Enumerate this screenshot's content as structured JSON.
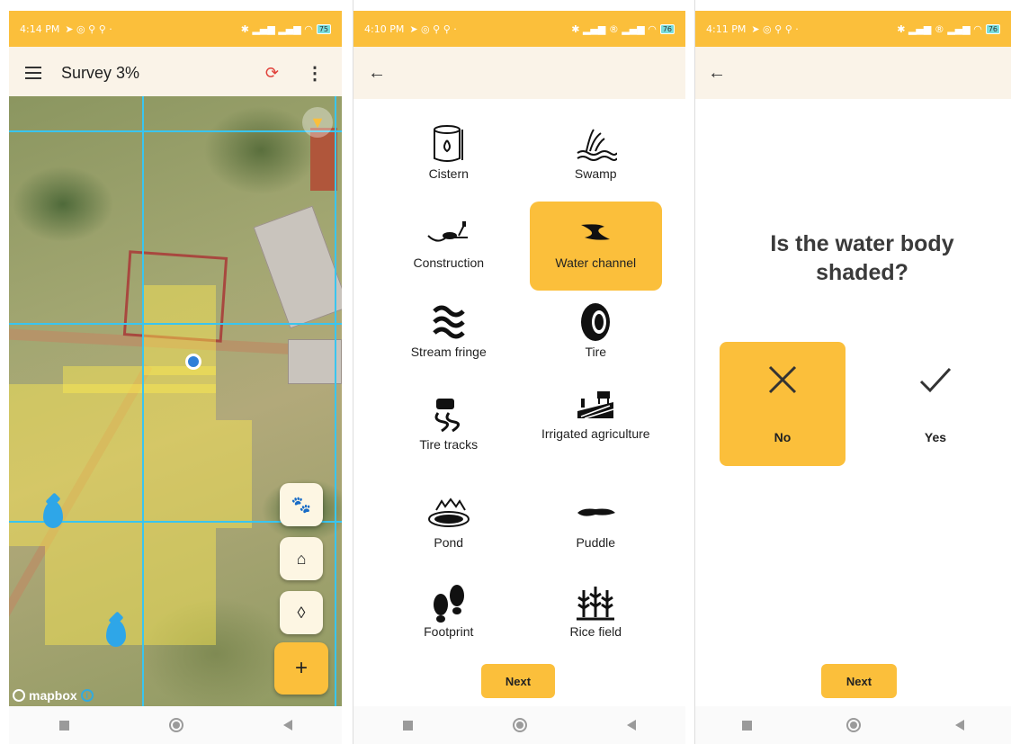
{
  "screens": {
    "map": {
      "status_time": "4:14 PM",
      "battery": "75",
      "title": "Survey 3%",
      "menu_icon": "hamburger-menu-icon",
      "sync_icon": "sync-off-icon",
      "more_icon": "more-vertical-icon",
      "layer_icon": "wifi-signal-icon",
      "map_attribution": "mapbox",
      "fab_actions": [
        "paw-icon",
        "home-icon",
        "water-drop-plus-icon"
      ],
      "fab_add": "+"
    },
    "categories": {
      "status_time": "4:10 PM",
      "battery": "76",
      "items": [
        {
          "label": "Cistern",
          "icon": "cistern-icon",
          "selected": false
        },
        {
          "label": "Swamp",
          "icon": "swamp-icon",
          "selected": false
        },
        {
          "label": "Construction",
          "icon": "construction-icon",
          "selected": false
        },
        {
          "label": "Water channel",
          "icon": "water-channel-icon",
          "selected": true
        },
        {
          "label": "Stream fringe",
          "icon": "stream-fringe-icon",
          "selected": false
        },
        {
          "label": "Tire",
          "icon": "tire-icon",
          "selected": false
        },
        {
          "label": "Tire tracks",
          "icon": "tire-tracks-icon",
          "selected": false
        },
        {
          "label": "Irrigated agriculture",
          "icon": "irrigated-agriculture-icon",
          "selected": false
        },
        {
          "label": "Pond",
          "icon": "pond-icon",
          "selected": false
        },
        {
          "label": "Puddle",
          "icon": "puddle-icon",
          "selected": false
        },
        {
          "label": "Footprint",
          "icon": "footprint-icon",
          "selected": false
        },
        {
          "label": "Rice field",
          "icon": "rice-field-icon",
          "selected": false
        }
      ],
      "next_label": "Next"
    },
    "question": {
      "status_time": "4:11 PM",
      "battery": "76",
      "question_text": "Is the water body shaded?",
      "options": [
        {
          "label": "No",
          "icon": "close-icon",
          "selected": true
        },
        {
          "label": "Yes",
          "icon": "check-icon",
          "selected": false
        }
      ],
      "next_label": "Next"
    }
  },
  "colors": {
    "accent": "#FBBF3B",
    "appbar": "#FAF3E8",
    "gridline": "#39c5f0"
  }
}
